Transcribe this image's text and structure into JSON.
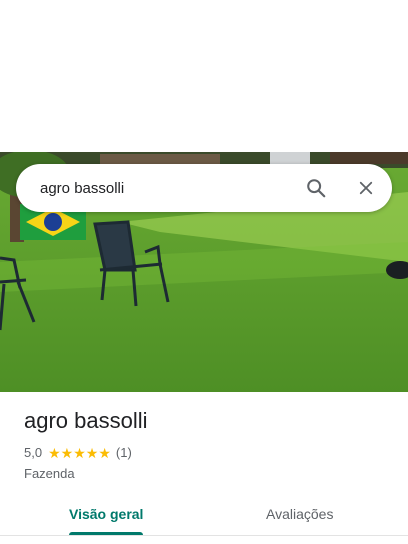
{
  "search": {
    "query": "agro bassolli"
  },
  "place": {
    "name": "agro bassolli",
    "rating": "5,0",
    "star_count": 5,
    "review_count": "(1)",
    "category": "Fazenda"
  },
  "tabs": [
    {
      "label": "Visão geral",
      "selected": true
    },
    {
      "label": "Avaliações",
      "selected": false
    }
  ],
  "colors": {
    "accent": "#00796b",
    "star": "#fbbc04",
    "grass": "#5a9e2a"
  },
  "icons": {
    "search": "search-icon",
    "clear": "close-icon"
  }
}
